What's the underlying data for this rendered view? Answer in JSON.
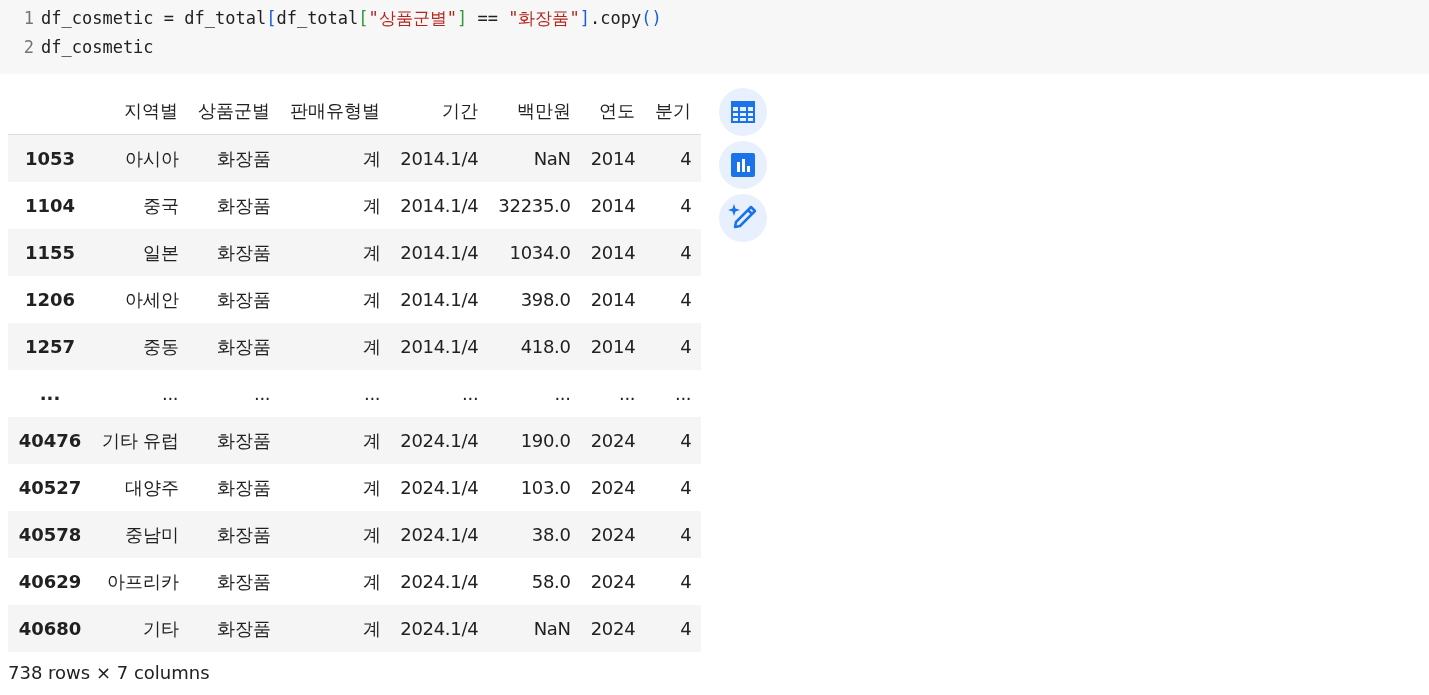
{
  "code": {
    "lines": [
      {
        "number": "1",
        "tokens": [
          {
            "kind": "plain",
            "text": "df_cosmetic = df_total"
          },
          {
            "kind": "bracket1",
            "text": "["
          },
          {
            "kind": "plain",
            "text": "df_total"
          },
          {
            "kind": "bracket2",
            "text": "["
          },
          {
            "kind": "string",
            "text": "\"상품군별\""
          },
          {
            "kind": "bracket2",
            "text": "]"
          },
          {
            "kind": "plain",
            "text": " == "
          },
          {
            "kind": "string",
            "text": "\"화장품\""
          },
          {
            "kind": "bracket1",
            "text": "]"
          },
          {
            "kind": "plain",
            "text": ".copy"
          },
          {
            "kind": "bracket1",
            "text": "()"
          }
        ]
      },
      {
        "number": "2",
        "tokens": [
          {
            "kind": "plain",
            "text": "df_cosmetic"
          }
        ]
      }
    ]
  },
  "table": {
    "columns": [
      "지역별",
      "상품군별",
      "판매유형별",
      "기간",
      "백만원",
      "연도",
      "분기"
    ],
    "rows": [
      {
        "index": "1053",
        "cells": [
          "아시아",
          "화장품",
          "계",
          "2014.1/4",
          "NaN",
          "2014",
          "4"
        ]
      },
      {
        "index": "1104",
        "cells": [
          "중국",
          "화장품",
          "계",
          "2014.1/4",
          "32235.0",
          "2014",
          "4"
        ]
      },
      {
        "index": "1155",
        "cells": [
          "일본",
          "화장품",
          "계",
          "2014.1/4",
          "1034.0",
          "2014",
          "4"
        ]
      },
      {
        "index": "1206",
        "cells": [
          "아세안",
          "화장품",
          "계",
          "2014.1/4",
          "398.0",
          "2014",
          "4"
        ]
      },
      {
        "index": "1257",
        "cells": [
          "중동",
          "화장품",
          "계",
          "2014.1/4",
          "418.0",
          "2014",
          "4"
        ]
      },
      {
        "index": "...",
        "cells": [
          "...",
          "...",
          "...",
          "...",
          "...",
          "...",
          "..."
        ]
      },
      {
        "index": "40476",
        "cells": [
          "기타 유럽",
          "화장품",
          "계",
          "2024.1/4",
          "190.0",
          "2024",
          "4"
        ]
      },
      {
        "index": "40527",
        "cells": [
          "대양주",
          "화장품",
          "계",
          "2024.1/4",
          "103.0",
          "2024",
          "4"
        ]
      },
      {
        "index": "40578",
        "cells": [
          "중남미",
          "화장품",
          "계",
          "2024.1/4",
          "38.0",
          "2024",
          "4"
        ]
      },
      {
        "index": "40629",
        "cells": [
          "아프리카",
          "화장품",
          "계",
          "2024.1/4",
          "58.0",
          "2024",
          "4"
        ]
      },
      {
        "index": "40680",
        "cells": [
          "기타",
          "화장품",
          "계",
          "2024.1/4",
          "NaN",
          "2024",
          "4"
        ]
      }
    ]
  },
  "shape_note": "738 rows × 7 columns",
  "tools": [
    {
      "kind": "table"
    },
    {
      "kind": "chart"
    },
    {
      "kind": "magic"
    }
  ]
}
